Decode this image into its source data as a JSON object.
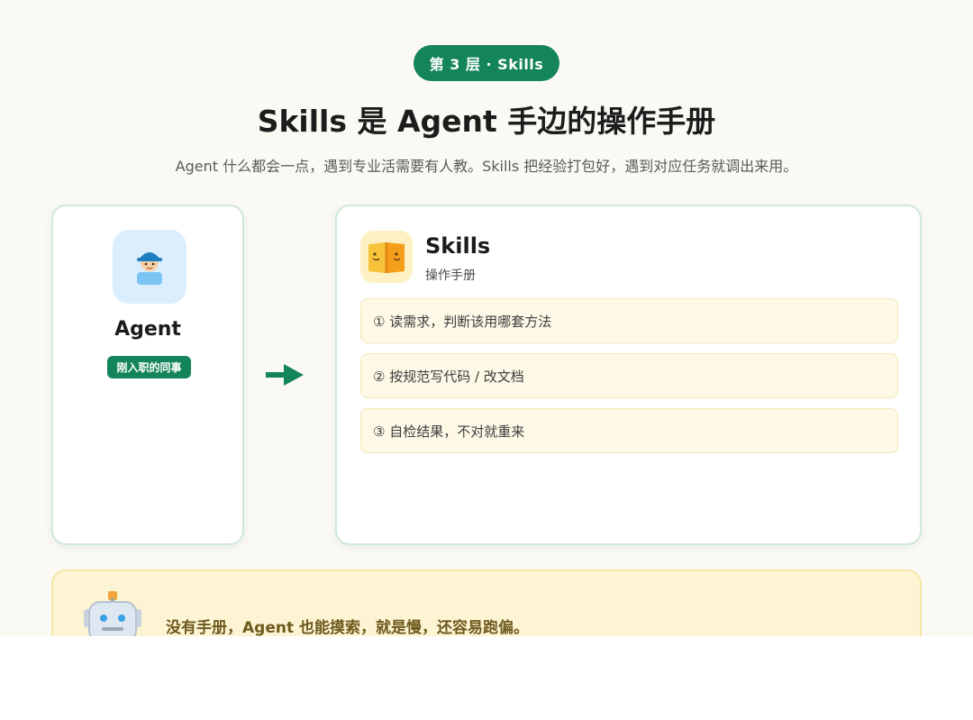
{
  "layer_badge": "第 3 层 · Skills",
  "title": "Skills 是 Agent 手边的操作手册",
  "subtitle": "Agent 什么都会一点，遇到专业活需要有人教。Skills 把经验打包好，遇到对应任务就调出来用。",
  "agent": {
    "icon": "worker-avatar-icon",
    "name": "Agent",
    "badge": "刚入职的同事"
  },
  "arrow_icon": "arrow-right-icon",
  "skills": {
    "icon": "open-book-icon",
    "title": "Skills",
    "subtitle": "操作手册",
    "steps": [
      "① 读需求，判断该用哪套方法",
      "② 按规范写代码 / 改文档",
      "③ 自检结果，不对就重来"
    ]
  },
  "note": {
    "icon": "robot-icon",
    "text": "没有手册，Agent 也能摸索，就是慢，还容易跑偏。"
  },
  "colors": {
    "accent": "#14855a",
    "background": "#fbf9f3",
    "step_bg": "#fef9e6",
    "note_bg": "#fdf4d3"
  }
}
